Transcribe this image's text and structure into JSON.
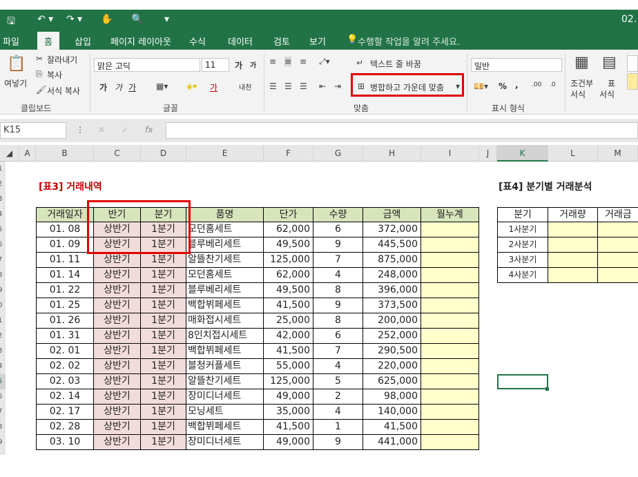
{
  "titlebar": {
    "icons": [
      "save-icon",
      "undo-icon",
      "redo-icon",
      "touch-mode-icon",
      "print-preview-icon",
      "customize-icon"
    ],
    "title_right": "02."
  },
  "tabs": [
    "파일",
    "홈",
    "삽입",
    "페이지 레이아웃",
    "수식",
    "데이터",
    "검토",
    "보기"
  ],
  "tellme": "수행할 작업을 알려 주세요.",
  "ribbon": {
    "clipboard": {
      "paste": "여넣기",
      "cut": "잘라내기",
      "copy": "복사",
      "format_painter": "서식 복사",
      "label": "클립보드"
    },
    "font": {
      "name": "맑은 고딕",
      "size": "11",
      "grow": "가",
      "shrink": "가",
      "bold": "가",
      "italic": "가",
      "underline": "가",
      "phonetic": "내천",
      "color_a": "가",
      "label": "글꼴"
    },
    "alignment": {
      "wrap": "텍스트 줄 바꿈",
      "merge": "병합하고 가운데 맞춤",
      "label": "맞춤"
    },
    "number": {
      "format": "일반",
      "percent": "%",
      "comma": ",",
      "inc": ".00",
      "dec": ".0",
      "label": "표시 형식"
    },
    "styles": {
      "conditional": "조건부",
      "conditional2": "서식",
      "table": "표",
      "table2": "서식"
    }
  },
  "formula_bar": {
    "name_box": "K15",
    "fx": "fx"
  },
  "columns": [
    "A",
    "B",
    "C",
    "D",
    "E",
    "F",
    "G",
    "H",
    "I",
    "J",
    "K",
    "L",
    "M"
  ],
  "row_numbers": [
    "1",
    "2",
    "3",
    "4",
    "5",
    "6",
    "7",
    "8",
    "9",
    "0",
    "1",
    "2",
    "3",
    "4",
    "5",
    "6",
    "7",
    "8",
    "9"
  ],
  "table3": {
    "title": "[표3] 거래내역",
    "headers": [
      "거래일자",
      "반기",
      "분기",
      "품명",
      "단가",
      "수량",
      "금액",
      "월누계"
    ],
    "rows": [
      [
        "01. 08",
        "상반기",
        "1분기",
        "모던홈세트",
        "62,000",
        "6",
        "372,000",
        ""
      ],
      [
        "01. 09",
        "상반기",
        "1분기",
        "블루베리세트",
        "49,500",
        "9",
        "445,500",
        ""
      ],
      [
        "01. 11",
        "상반기",
        "1분기",
        "알뜰찬기세트",
        "125,000",
        "7",
        "875,000",
        ""
      ],
      [
        "01. 14",
        "상반기",
        "1분기",
        "모던홈세트",
        "62,000",
        "4",
        "248,000",
        ""
      ],
      [
        "01. 22",
        "상반기",
        "1분기",
        "블루베리세트",
        "49,500",
        "8",
        "396,000",
        ""
      ],
      [
        "01. 25",
        "상반기",
        "1분기",
        "백합뷔페세트",
        "41,500",
        "9",
        "373,500",
        ""
      ],
      [
        "01. 26",
        "상반기",
        "1분기",
        "매화접시세트",
        "25,000",
        "8",
        "200,000",
        ""
      ],
      [
        "01. 31",
        "상반기",
        "1분기",
        "8인치접시세트",
        "42,000",
        "6",
        "252,000",
        ""
      ],
      [
        "02. 01",
        "상반기",
        "1분기",
        "백합뷔페세트",
        "41,500",
        "7",
        "290,500",
        ""
      ],
      [
        "02. 02",
        "상반기",
        "1분기",
        "블청커플세트",
        "55,000",
        "4",
        "220,000",
        ""
      ],
      [
        "02. 03",
        "상반기",
        "1분기",
        "알뜰찬기세트",
        "125,000",
        "5",
        "625,000",
        ""
      ],
      [
        "02. 14",
        "상반기",
        "1분기",
        "장미디너세트",
        "49,000",
        "2",
        "98,000",
        ""
      ],
      [
        "02. 17",
        "상반기",
        "1분기",
        "모닝세트",
        "35,000",
        "4",
        "140,000",
        ""
      ],
      [
        "02. 28",
        "상반기",
        "1분기",
        "백합뷔페세트",
        "41,500",
        "1",
        "41,500",
        ""
      ],
      [
        "03. 10",
        "상반기",
        "1분기",
        "장미디너세트",
        "49,000",
        "9",
        "441,000",
        ""
      ]
    ]
  },
  "table4": {
    "title": "[표4] 분기별 거래분석",
    "headers": [
      "분기",
      "거래량",
      "거래금"
    ],
    "rows": [
      [
        "1사분기",
        "",
        ""
      ],
      [
        "2사분기",
        "",
        ""
      ],
      [
        "3사분기",
        "",
        ""
      ],
      [
        "4사분기",
        "",
        ""
      ]
    ]
  },
  "colors": {
    "excel_green": "#217346",
    "header_fill": "#d8e4bc",
    "pink_fill": "#f2dcdb",
    "yellow_fill": "#ffffcc",
    "highlight_red": "#e00000"
  }
}
